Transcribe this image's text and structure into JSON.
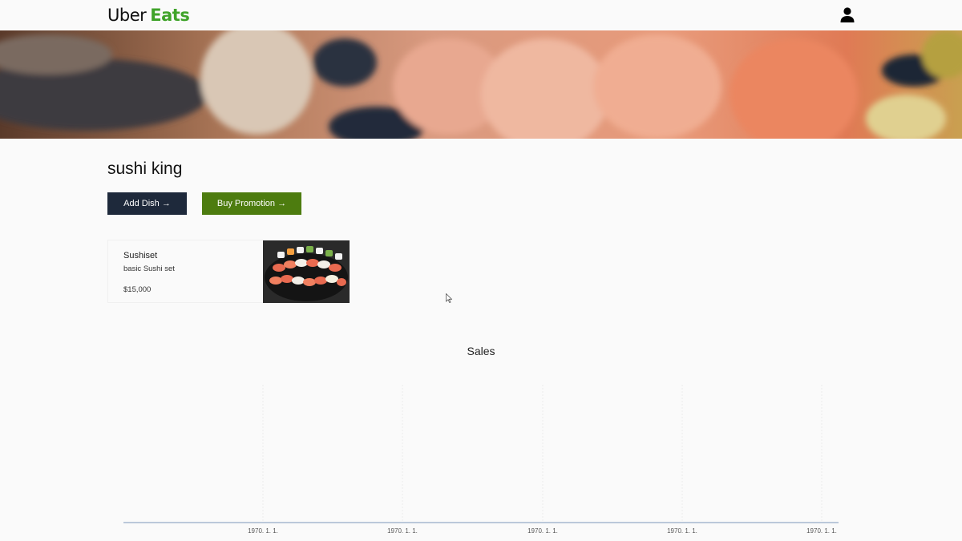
{
  "header": {
    "logo_uber": "Uber",
    "logo_eats": "Eats",
    "user_icon": "user-icon"
  },
  "restaurant": {
    "name": "sushi king",
    "add_dish_label": "Add Dish →",
    "buy_promotion_label": "Buy Promotion →"
  },
  "dishes": [
    {
      "name": "Sushiset",
      "description": "basic Sushi set",
      "price": "$15,000"
    }
  ],
  "colors": {
    "brand_green": "#3fa329",
    "add_dish_bg": "#1e293b",
    "promotion_bg": "#4d7c0f",
    "axis_line": "#7c97b9"
  },
  "chart_data": {
    "type": "line",
    "title": "Sales",
    "x_tick_labels": [
      "1970. 1. 1.",
      "1970. 1. 1.",
      "1970. 1. 1.",
      "1970. 1. 1.",
      "1970. 1. 1."
    ],
    "series": [],
    "grid": true
  }
}
